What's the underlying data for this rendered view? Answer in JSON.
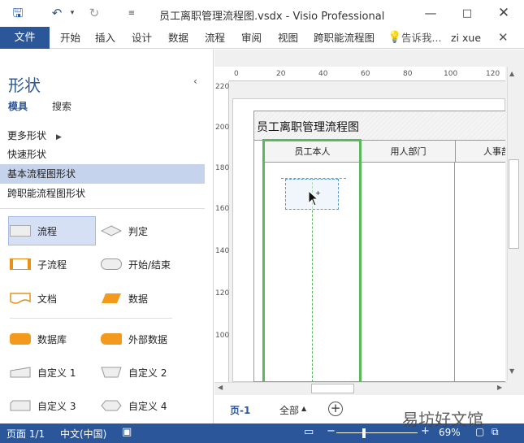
{
  "title": "员工离职管理流程图.vsdx - Visio Professional",
  "qat": {
    "save_icon": "save-icon",
    "undo_icon": "undo-icon",
    "redo_icon": "redo-icon"
  },
  "ribbon": {
    "file": "文件",
    "tabs": [
      "开始",
      "插入",
      "设计",
      "数据",
      "流程",
      "审阅",
      "视图",
      "跨职能流程图"
    ],
    "tell_me": "告诉我...",
    "user": "zi xue"
  },
  "shapes_pane": {
    "title": "形状",
    "tab_stencils": "模具",
    "tab_search": "搜索",
    "sections": [
      "更多形状",
      "快速形状",
      "基本流程图形状",
      "跨职能流程图形状"
    ],
    "shapes": [
      {
        "label": "流程"
      },
      {
        "label": "判定"
      },
      {
        "label": "子流程"
      },
      {
        "label": "开始/结束"
      },
      {
        "label": "文档"
      },
      {
        "label": "数据"
      },
      {
        "label": "数据库"
      },
      {
        "label": "外部数据"
      },
      {
        "label": "自定义 1"
      },
      {
        "label": "自定义 2"
      },
      {
        "label": "自定义 3"
      },
      {
        "label": "自定义 4"
      }
    ]
  },
  "ruler": {
    "h": [
      "0",
      "20",
      "40",
      "60",
      "80",
      "100",
      "120"
    ],
    "v": [
      "220",
      "200",
      "180",
      "160",
      "140",
      "120",
      "100"
    ]
  },
  "diagram": {
    "title": "员工离职管理流程图",
    "lanes": [
      "员工本人",
      "用人部门",
      "人事部"
    ]
  },
  "bottom": {
    "page": "页-1",
    "all": "全部"
  },
  "status": {
    "page": "页面 1/1",
    "lang": "中文(中国)",
    "zoom": "69%"
  },
  "watermark": "易坊好文馆"
}
